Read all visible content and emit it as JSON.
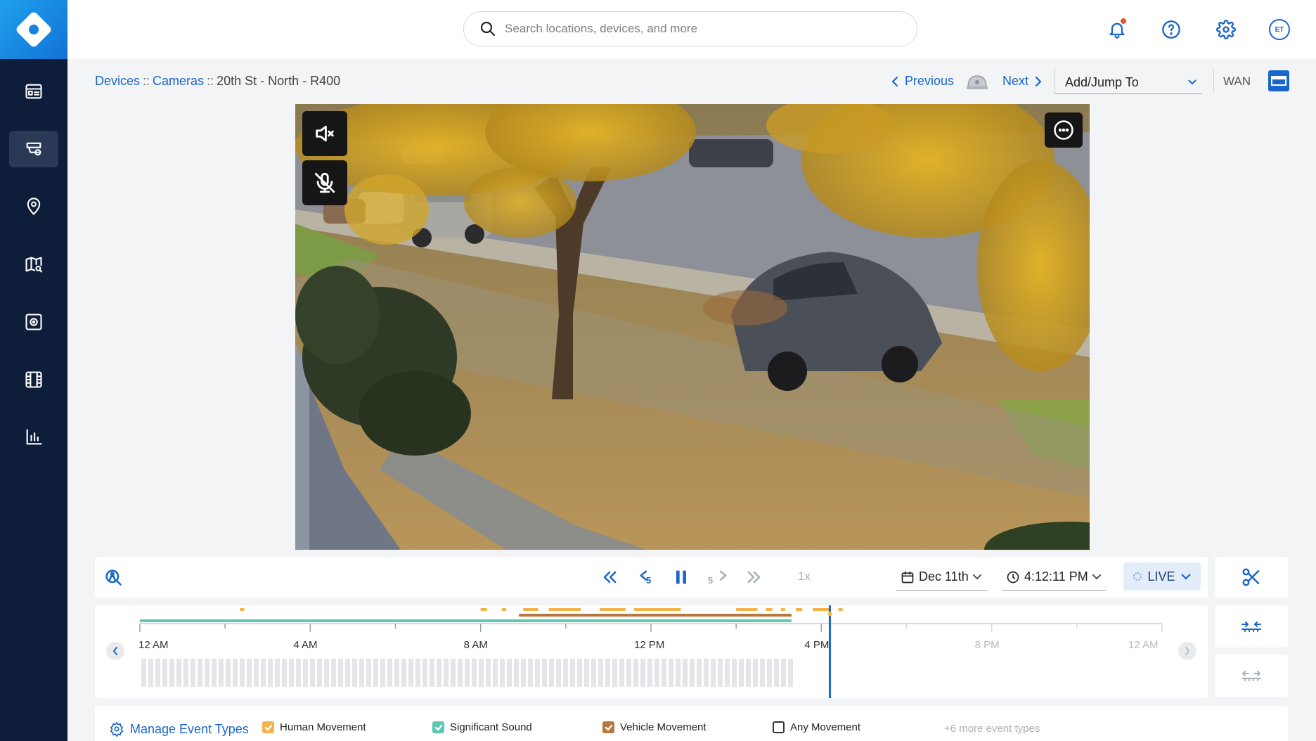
{
  "search": {
    "placeholder": "Search locations, devices, and more"
  },
  "header": {
    "avatar_initials": "ET"
  },
  "breadcrumb": {
    "devices": "Devices",
    "cameras": "Cameras",
    "separator": "::",
    "current": "20th St - North - R400"
  },
  "device_nav": {
    "previous": "Previous",
    "next": "Next",
    "jump_label": "Add/Jump To",
    "connection": "WAN"
  },
  "playback": {
    "speed": "1x",
    "date": "Dec 11th",
    "time": "4:12:11 PM",
    "live_label": "LIVE",
    "rewind_step": "5",
    "forward_step": "5"
  },
  "timeline": {
    "ticks": [
      "12 AM",
      "4 AM",
      "8 AM",
      "12 PM",
      "4 PM",
      "8 PM",
      "12 AM"
    ],
    "playhead_hours": 16.2,
    "recorded_until_hours": 15.3,
    "colors": {
      "human": "#f4b24a",
      "sound": "#5fc8b3",
      "vehicle": "#b5773f",
      "playhead": "#1b66c9"
    }
  },
  "legend": {
    "manage_label": "Manage Event Types",
    "items": [
      {
        "label": "Human Movement",
        "checked": true,
        "color": "#f4b24a"
      },
      {
        "label": "Significant Sound",
        "checked": true,
        "color": "#5fc8b3"
      },
      {
        "label": "Vehicle Movement",
        "checked": true,
        "color": "#b5773f"
      },
      {
        "label": "Any Movement",
        "checked": false,
        "color": "#333333"
      }
    ],
    "more_label": "+6 more event types"
  },
  "colors": {
    "sidebar_bg": "#0e1e3a",
    "accent": "#1b66c9"
  }
}
